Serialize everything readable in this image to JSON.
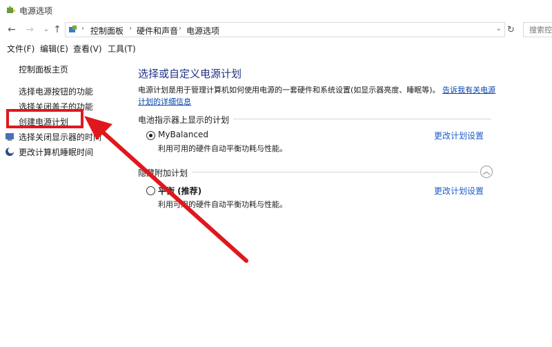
{
  "window": {
    "title": "电源选项"
  },
  "address_bar": {
    "breadcrumbs": [
      "控制面板",
      "硬件和声音",
      "电源选项"
    ],
    "search_placeholder": "搜索控"
  },
  "menu": {
    "items": [
      "文件(F)",
      "编辑(E)",
      "查看(V)",
      "工具(T)"
    ]
  },
  "sidebar": {
    "items": [
      {
        "label": "控制面板主页"
      },
      {
        "label": "选择电源按钮的功能"
      },
      {
        "label": "选择关闭盖子的功能"
      },
      {
        "label": "创建电源计划"
      },
      {
        "label": "选择关闭显示器的时间"
      },
      {
        "label": "更改计算机睡眠时间"
      }
    ]
  },
  "main": {
    "title": "选择或自定义电源计划",
    "description": "电源计划是用于管理计算机如何使用电源的一套硬件和系统设置(如显示器亮度、睡眠等)。",
    "description_link": "告诉我有关电源计划的详细信息",
    "groups": [
      {
        "label": "电池指示器上显示的计划",
        "plan": {
          "name": "MyBalanced",
          "desc": "利用可用的硬件自动平衡功耗与性能。",
          "change": "更改计划设置",
          "selected": true
        }
      },
      {
        "label": "隐藏附加计划",
        "plan": {
          "name": "平衡 (推荐)",
          "desc": "利用可用的硬件自动平衡功耗与性能。",
          "change": "更改计划设置",
          "selected": false
        }
      }
    ]
  },
  "colors": {
    "annotation": "#e0171d",
    "link": "#1e5bc6",
    "title": "#1e3287"
  }
}
